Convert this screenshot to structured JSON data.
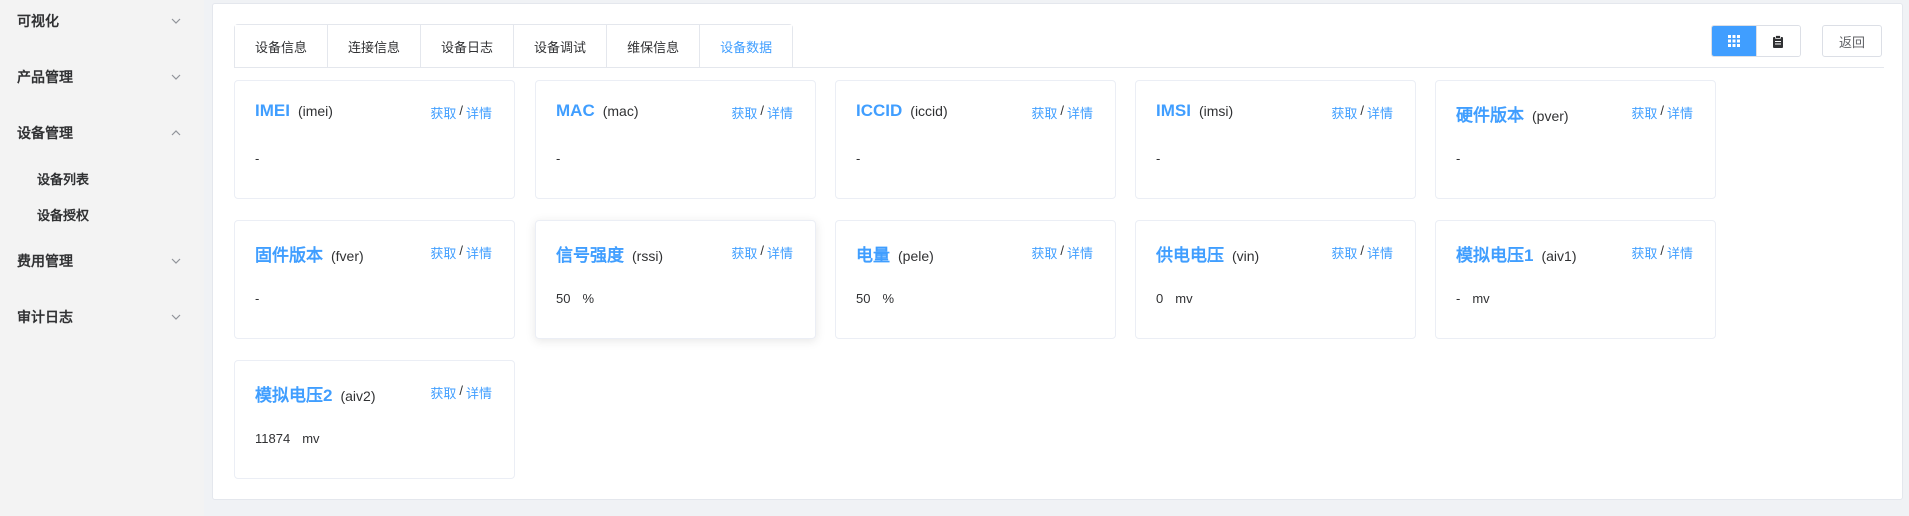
{
  "sidebar": {
    "menus": [
      {
        "label": "可视化",
        "expanded": false
      },
      {
        "label": "产品管理",
        "expanded": false
      },
      {
        "label": "设备管理",
        "expanded": true
      },
      {
        "label": "费用管理",
        "expanded": false
      },
      {
        "label": "审计日志",
        "expanded": false
      }
    ],
    "sub_items": [
      "设备列表",
      "设备授权"
    ]
  },
  "tabs": [
    "设备信息",
    "连接信息",
    "设备日志",
    "设备调试",
    "维保信息",
    "设备数据"
  ],
  "active_tab": "设备数据",
  "toolbar": {
    "grid_icon": "grid-icon",
    "list_icon": "clipboard-icon",
    "back_label": "返回"
  },
  "colors": {
    "accent": "#409eff",
    "text": "#303133",
    "sidebar_bg": "#f3f3f3"
  },
  "cards": [
    {
      "name": "IMEI",
      "key": "(imei)",
      "value": "-",
      "unit": ""
    },
    {
      "name": "MAC",
      "key": "(mac)",
      "value": "-",
      "unit": ""
    },
    {
      "name": "ICCID",
      "key": "(iccid)",
      "value": "-",
      "unit": ""
    },
    {
      "name": "IMSI",
      "key": "(imsi)",
      "value": "-",
      "unit": ""
    },
    {
      "name": "硬件版本",
      "key": "(pver)",
      "value": "-",
      "unit": ""
    },
    {
      "name": "固件版本",
      "key": "(fver)",
      "value": "-",
      "unit": ""
    },
    {
      "name": "信号强度",
      "key": "(rssi)",
      "value": "50",
      "unit": "%"
    },
    {
      "name": "电量",
      "key": "(pele)",
      "value": "50",
      "unit": "%"
    },
    {
      "name": "供电电压",
      "key": "(vin)",
      "value": "0",
      "unit": "mv"
    },
    {
      "name": "模拟电压1",
      "key": "(aiv1)",
      "value": "-",
      "unit": "mv"
    },
    {
      "name": "模拟电压2",
      "key": "(aiv2)",
      "value": "11874",
      "unit": "mv"
    }
  ],
  "card_actions": {
    "fetch_label": "获取",
    "separator": "/",
    "detail_label": "详情"
  }
}
